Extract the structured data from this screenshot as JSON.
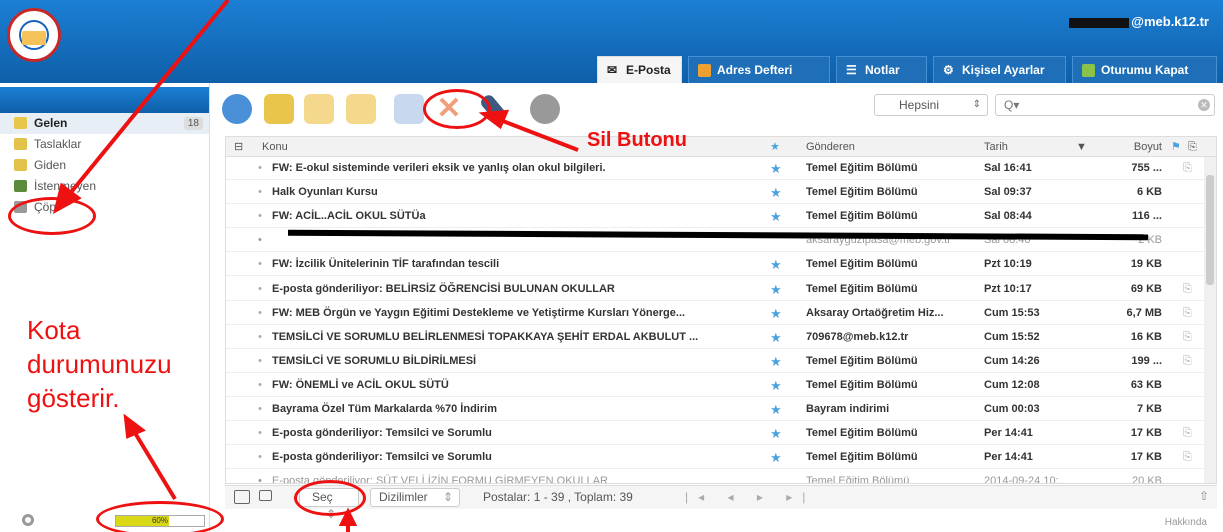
{
  "header": {
    "user_email": "@meb.k12.tr",
    "tabs": [
      {
        "label": "E-Posta",
        "icon": "envelope-icon"
      },
      {
        "label": "Adres Defteri",
        "icon": "address-book-icon"
      },
      {
        "label": "Notlar",
        "icon": "notes-icon"
      },
      {
        "label": "Kişisel Ayarlar",
        "icon": "gear-icon"
      },
      {
        "label": "Oturumu Kapat",
        "icon": "logout-icon"
      }
    ]
  },
  "sidebar": {
    "folders": [
      {
        "label": "Gelen",
        "count": "18"
      },
      {
        "label": "Taslaklar"
      },
      {
        "label": "Giden"
      },
      {
        "label": "İstenmeyen"
      },
      {
        "label": "Çöp"
      }
    ]
  },
  "toolbar": {
    "filter_value": "Hepsini",
    "search_placeholder": "Q▾"
  },
  "columns": {
    "subject": "Konu",
    "from": "Gönderen",
    "date": "Tarih",
    "size": "Boyut"
  },
  "messages": [
    {
      "subject": "FW: E-okul sisteminde verileri eksik ve yanlış olan okul bilgileri.",
      "from": "Temel Eğitim Bölümü",
      "date": "Sal 16:41",
      "size": "755 ...",
      "attach": true
    },
    {
      "subject": "Halk Oyunları Kursu",
      "from": "Temel Eğitim Bölümü",
      "date": "Sal 09:37",
      "size": "6 KB",
      "attach": false
    },
    {
      "subject": "FW: ACİL..ACİL OKUL SÜTÜa",
      "from": "Temel Eğitim Bölümü",
      "date": "Sal 08:44",
      "size": "116 ...",
      "attach": false
    },
    {
      "subject": "",
      "from": "aksarayguzipasa@meb.gov.tr",
      "date": "Sal 08:40",
      "size": "2 KB",
      "attach": false,
      "faint": true
    },
    {
      "subject": "FW: İzcilik Ünitelerinin TİF tarafından tescili",
      "from": "Temel Eğitim Bölümü",
      "date": "Pzt 10:19",
      "size": "19 KB",
      "attach": false
    },
    {
      "subject": "E-posta gönderiliyor: BELİRSİZ ÖĞRENCİSİ BULUNAN OKULLAR",
      "from": "Temel Eğitim Bölümü",
      "date": "Pzt 10:17",
      "size": "69 KB",
      "attach": true
    },
    {
      "subject": "FW: MEB Örgün ve Yaygın Eğitimi Destekleme ve Yetiştirme Kursları Yönerge...",
      "from": "Aksaray Ortaöğretim Hiz...",
      "date": "Cum 15:53",
      "size": "6,7 MB",
      "attach": true
    },
    {
      "subject": "TEMSİLCİ VE SORUMLU BELİRLENMESİ TOPAKKAYA ŞEHİT ERDAL AKBULUT ...",
      "from": "709678@meb.k12.tr",
      "date": "Cum 15:52",
      "size": "16 KB",
      "attach": true
    },
    {
      "subject": "TEMSİLCİ VE SORUMLU BİLDİRİLMESİ",
      "from": "Temel Eğitim Bölümü",
      "date": "Cum 14:26",
      "size": "199 ...",
      "attach": true
    },
    {
      "subject": "FW: ÖNEMLİ ve ACİL OKUL SÜTÜ",
      "from": "Temel Eğitim Bölümü",
      "date": "Cum 12:08",
      "size": "63 KB",
      "attach": false
    },
    {
      "subject": "Bayrama Özel Tüm Markalarda %70 İndirim",
      "from": "Bayram indirimi",
      "date": "Cum 00:03",
      "size": "7 KB",
      "attach": false
    },
    {
      "subject": "E-posta gönderiliyor: Temsilci ve Sorumlu",
      "from": "Temel Eğitim Bölümü",
      "date": "Per 14:41",
      "size": "17 KB",
      "attach": true
    },
    {
      "subject": "E-posta gönderiliyor: Temsilci ve Sorumlu",
      "from": "Temel Eğitim Bölümü",
      "date": "Per 14:41",
      "size": "17 KB",
      "attach": true
    },
    {
      "subject": "E-posta gönderiliyor: SÜT VELİ İZİN FORMU GİRMEYEN OKULLAR",
      "from": "Temel Eğitim Bölümü",
      "date": "2014-09-24 10:...",
      "size": "20 KB",
      "attach": false,
      "faint": true
    }
  ],
  "footer": {
    "select_label": "Seç",
    "sort_label": "Dizilimler",
    "pagination": "Postalar: 1 - 39 , Toplam: 39",
    "about": "Hakkında"
  },
  "quota": {
    "percent": "60%",
    "fraction": 0.6
  },
  "annotations": {
    "delete": "Sil Butonu",
    "quota": [
      "Kota",
      "durumunuzu",
      "gösterir."
    ]
  }
}
